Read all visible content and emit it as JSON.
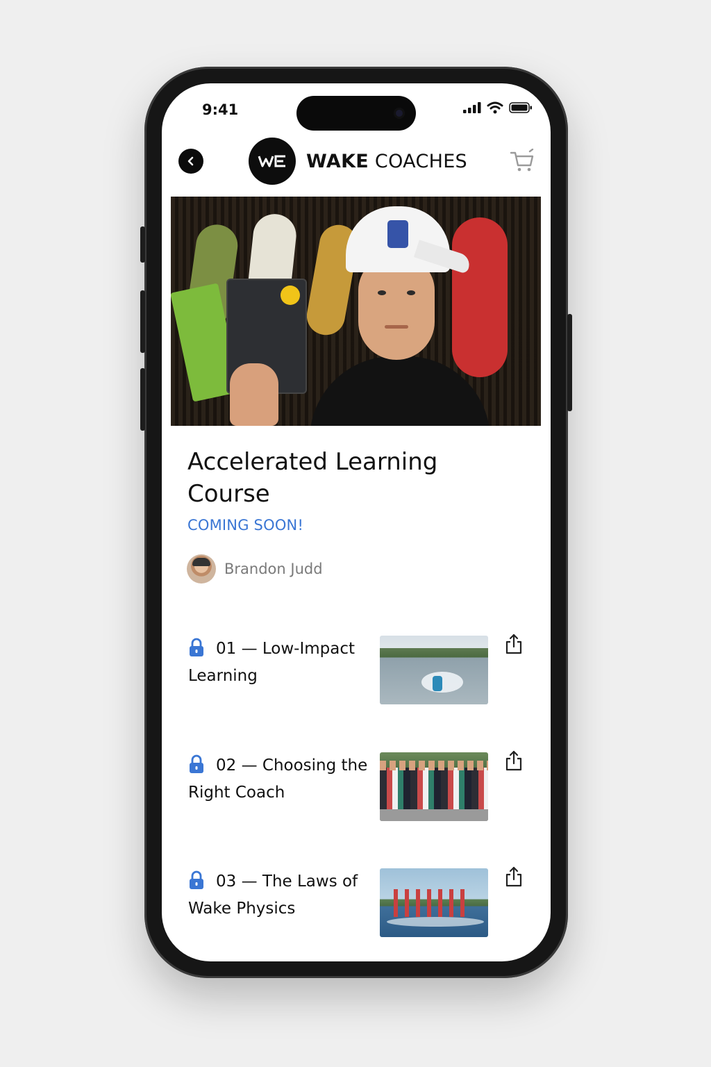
{
  "status_bar": {
    "time": "9:41"
  },
  "header": {
    "logo_mark": "WC",
    "brand_bold": "WAKE",
    "brand_light": " COACHES",
    "back_icon": "chevron-left-icon",
    "cart_icon": "cart-icon"
  },
  "course": {
    "title": "Accelerated Learning Course",
    "status": "COMING SOON!",
    "author": "Brandon Judd"
  },
  "lessons": [
    {
      "title": "01 — Low-Impact Learning",
      "locked": true,
      "thumb": "wakeboarder-spray"
    },
    {
      "title": "02 — Choosing the Right Coach",
      "locked": true,
      "thumb": "group-photo"
    },
    {
      "title": "03 — The Laws of Wake Physics",
      "locked": true,
      "thumb": "trick-sequence"
    }
  ],
  "colors": {
    "accent": "#3a76d4",
    "text": "#111111",
    "muted": "#7a7a7a"
  }
}
